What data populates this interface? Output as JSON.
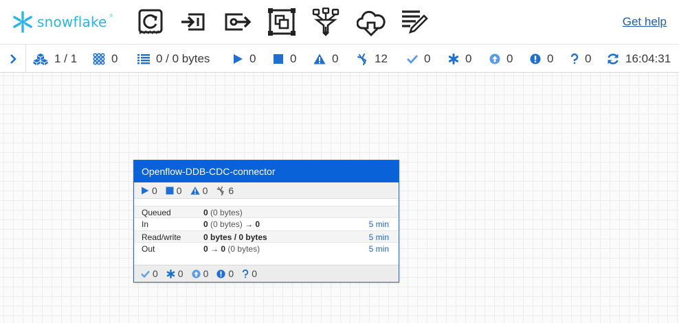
{
  "header": {
    "logo_text": "snowflake",
    "logo_mark": "®",
    "get_help": "Get help"
  },
  "colors": {
    "accent_blue": "#0a62d8",
    "icon_blue": "#1f6fd1",
    "brand": "#29b5e8",
    "link": "#1f5eae"
  },
  "status": {
    "components": "1 / 1",
    "processors": "0",
    "queued": "0 / 0 bytes",
    "running": "0",
    "stopped": "0",
    "invalid": "0",
    "disabled": "12",
    "up_to_date": "0",
    "locally_modified": "0",
    "stale": "0",
    "sync_failure": "0",
    "unknown": "0",
    "last_refresh": "16:04:31"
  },
  "process_group": {
    "name": "Openflow-DDB-CDC-connector",
    "stats": {
      "running": "0",
      "stopped": "0",
      "invalid": "0",
      "disabled": "6"
    },
    "rows": {
      "queued": {
        "label": "Queued",
        "count": "0",
        "size": "(0 bytes)"
      },
      "in": {
        "label": "In",
        "count": "0",
        "size": "(0 bytes)",
        "arrow": "→",
        "out": "0",
        "duration": "5 min"
      },
      "readwrite": {
        "label": "Read/write",
        "value": "0 bytes / 0 bytes",
        "duration": "5 min"
      },
      "out": {
        "label": "Out",
        "count": "0",
        "arrow": "→",
        "dest": "0",
        "size": "(0 bytes)",
        "duration": "5 min"
      }
    },
    "versions": {
      "up_to_date": "0",
      "locally_modified": "0",
      "stale": "0",
      "sync_failure": "0",
      "unknown": "0"
    }
  }
}
